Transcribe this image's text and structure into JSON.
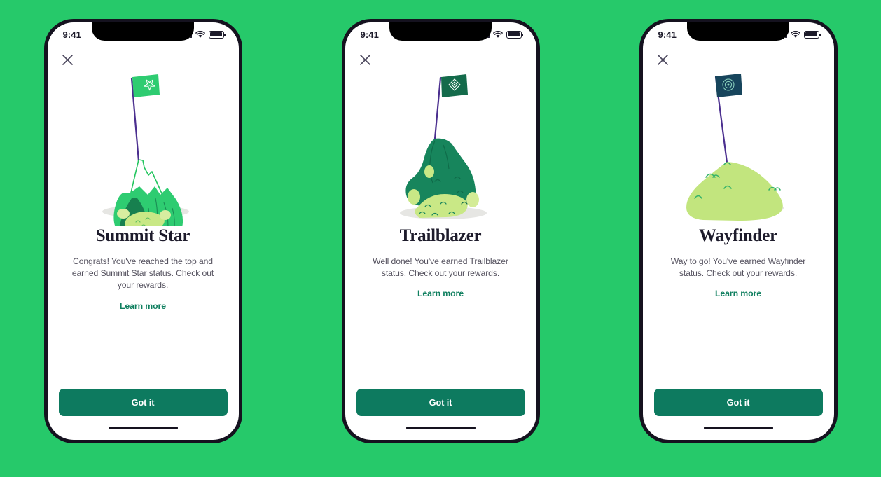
{
  "background_color": "#26c96a",
  "accent_color": "#0d7a5f",
  "link_color": "#0f7f5f",
  "screens": [
    {
      "id": "summit-star",
      "status": {
        "time": "9:41",
        "cellular_icon": "signal-bars-icon",
        "wifi_icon": "wifi-icon",
        "battery_icon": "battery-icon"
      },
      "close_label": "Close",
      "illustration": "mountain-peak-with-flag-illustration",
      "title": "Summit Star",
      "subtitle": "Congrats! You've reached the top and earned Summit Star status. Check out your rewards.",
      "learn_more": "Learn more",
      "cta": "Got it"
    },
    {
      "id": "trailblazer",
      "status": {
        "time": "9:41",
        "cellular_icon": "signal-bars-icon",
        "wifi_icon": "wifi-icon",
        "battery_icon": "battery-icon"
      },
      "close_label": "Close",
      "illustration": "green-hill-with-flag-illustration",
      "title": "Trailblazer",
      "subtitle": "Well done! You've earned Trailblazer status. Check out your rewards.",
      "learn_more": "Learn more",
      "cta": "Got it"
    },
    {
      "id": "wayfinder",
      "status": {
        "time": "9:41",
        "cellular_icon": "signal-bars-icon",
        "wifi_icon": "wifi-icon",
        "battery_icon": "battery-icon"
      },
      "close_label": "Close",
      "illustration": "low-mound-with-flag-illustration",
      "title": "Wayfinder",
      "subtitle": "Way to go! You've earned Wayfinder status. Check out your rewards.",
      "learn_more": "Learn more",
      "cta": "Got it"
    }
  ]
}
